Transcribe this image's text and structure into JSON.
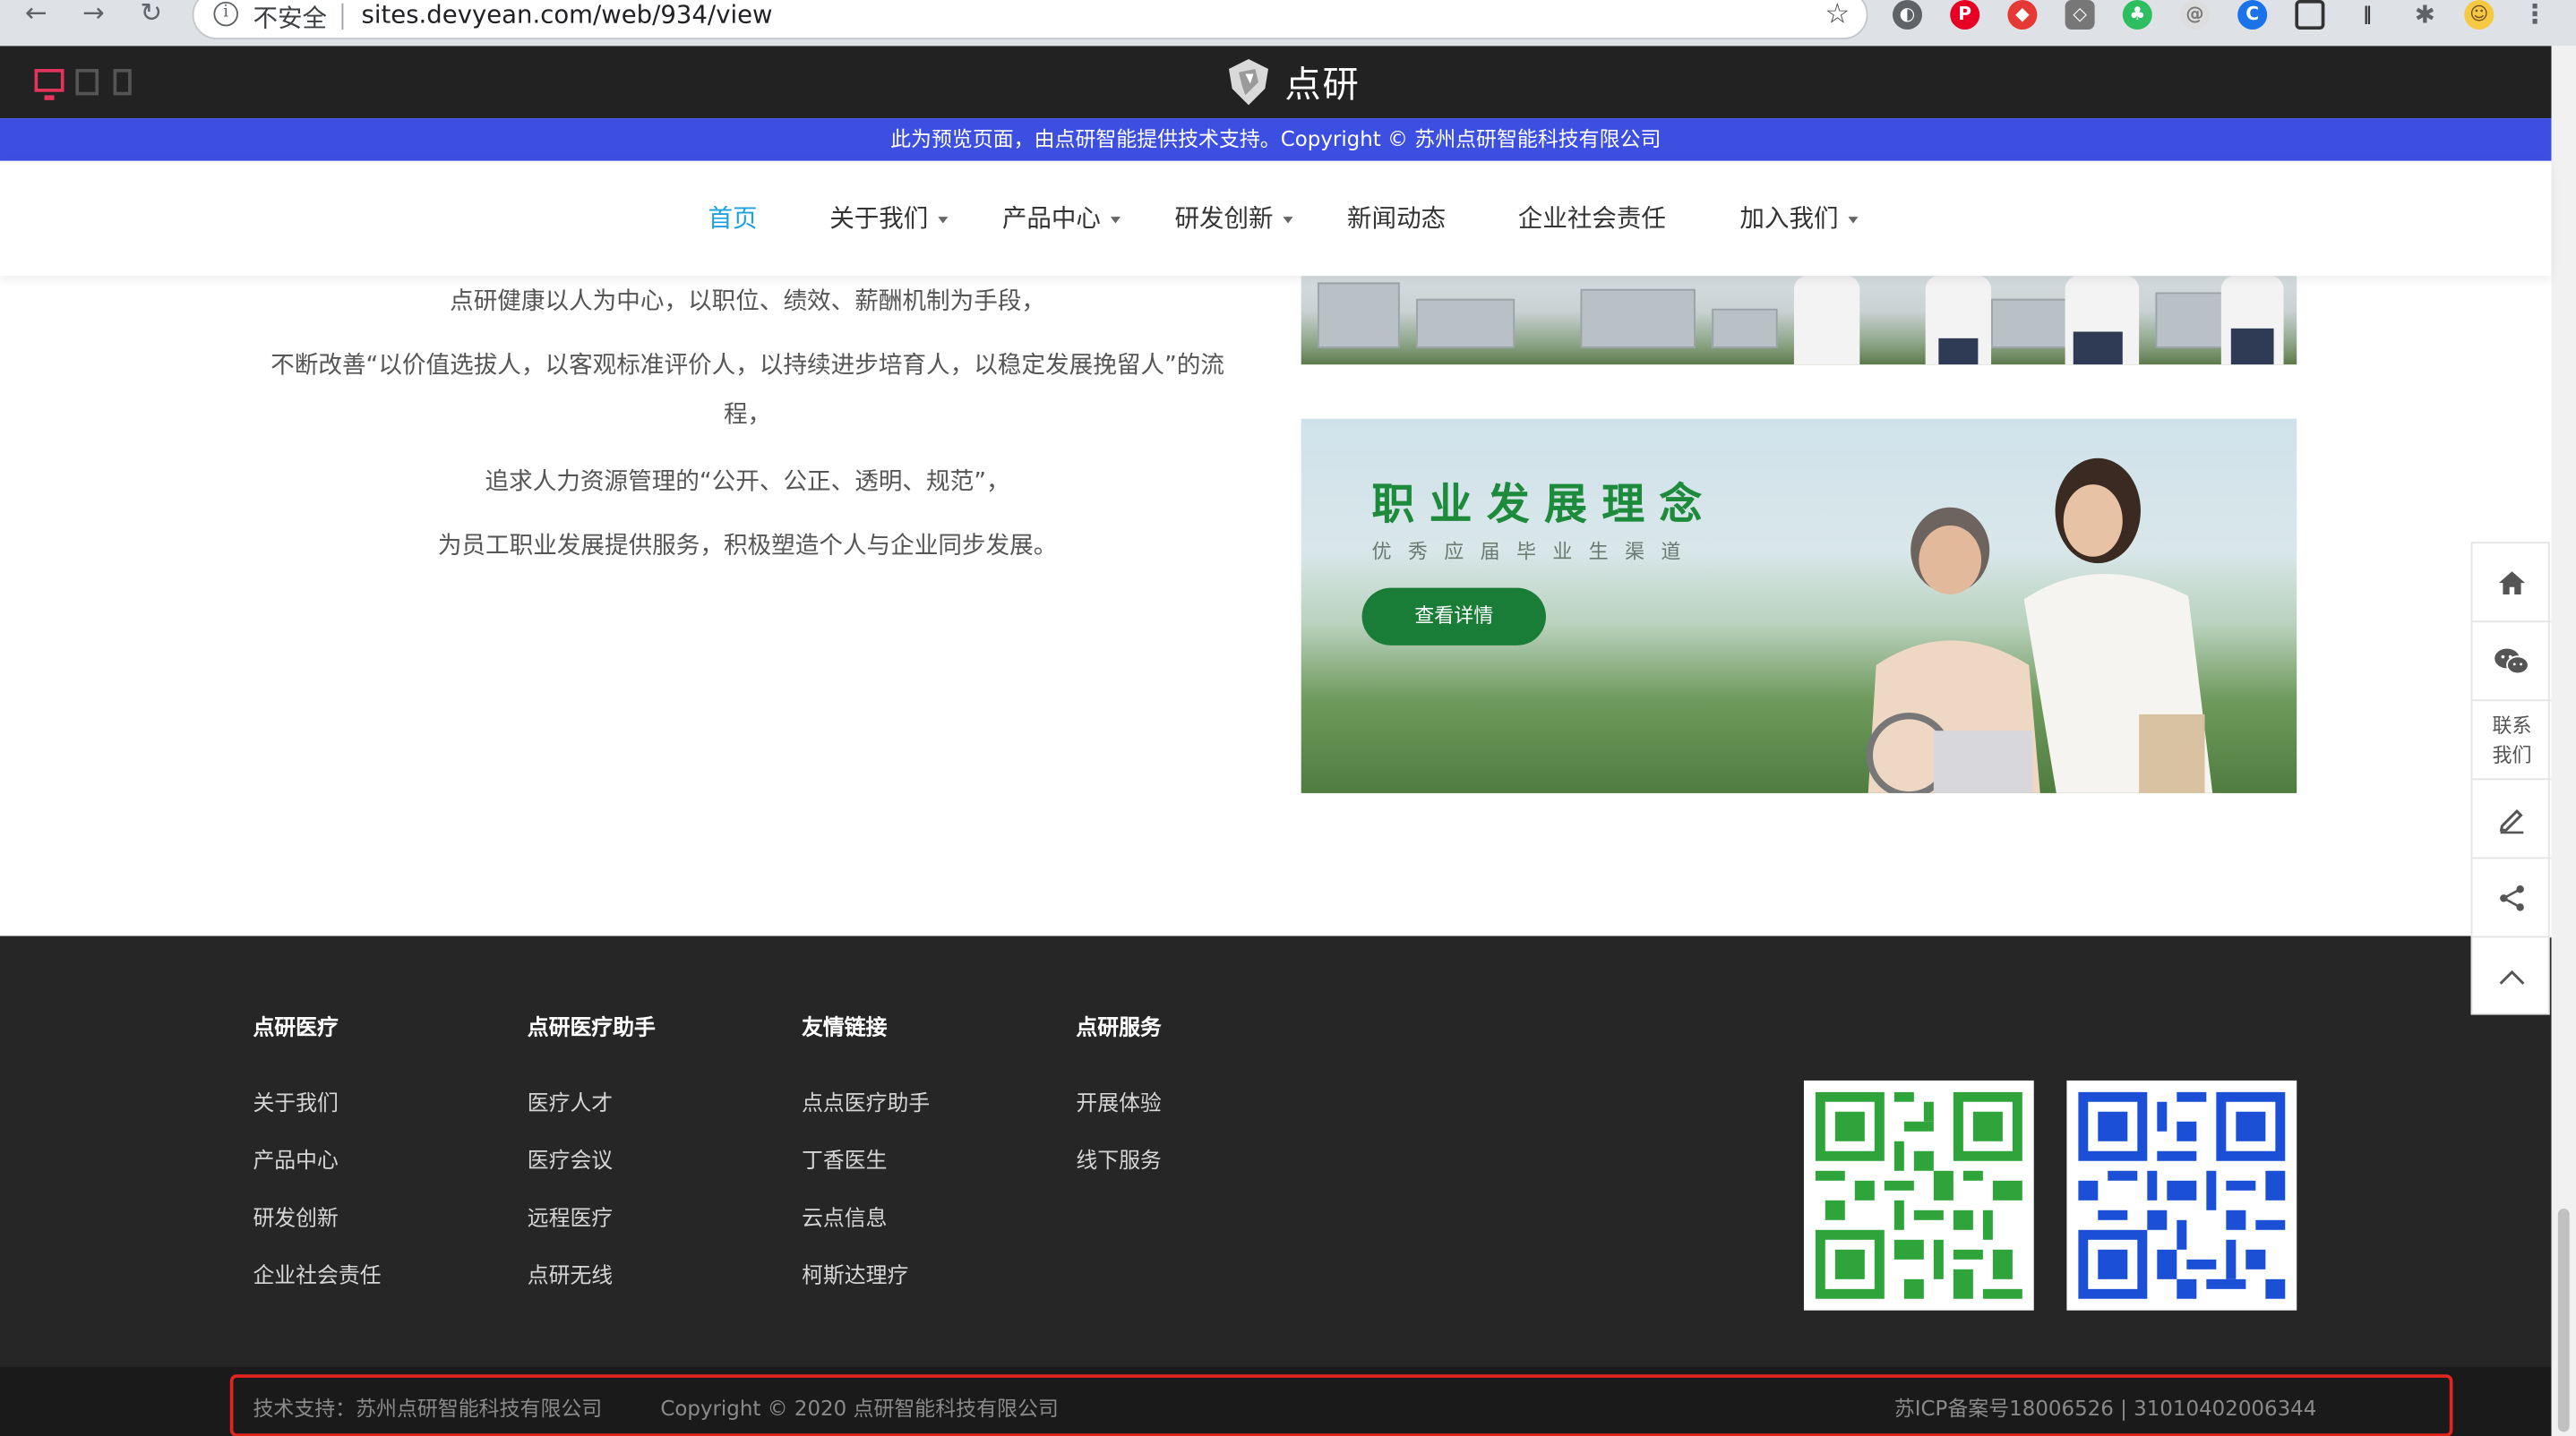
{
  "browser": {
    "insecure_label": "不安全",
    "url": "sites.devyean.com/web/934/view"
  },
  "site": {
    "brand": "点研",
    "notice": "此为预览页面，由点研智能提供技术支持。Copyright © 苏州点研智能科技有限公司"
  },
  "nav": {
    "items": [
      {
        "label": "首页"
      },
      {
        "label": "关于我们"
      },
      {
        "label": "产品中心"
      },
      {
        "label": "研发创新"
      },
      {
        "label": "新闻动态"
      },
      {
        "label": "企业社会责任"
      },
      {
        "label": "加入我们"
      }
    ]
  },
  "content": {
    "paragraphs": [
      "点研健康以人为中心，以职位、绩效、薪酬机制为手段，",
      "不断改善“以价值选拔人，以客观标准评价人，以持续进步培育人，以稳定发展挽留人”的流程，",
      "追求人力资源管理的“公开、公正、透明、规范”，",
      "为员工职业发展提供服务，积极塑造个人与企业同步发展。"
    ],
    "banner": {
      "title": "职业发展理念",
      "subtitle": "优秀应届毕业生渠道",
      "button": "查看详情"
    }
  },
  "footer": {
    "columns": [
      {
        "title": "点研医疗",
        "links": [
          "关于我们",
          "产品中心",
          "研发创新",
          "企业社会责任"
        ]
      },
      {
        "title": "点研医疗助手",
        "links": [
          "医疗人才",
          "医疗会议",
          "远程医疗",
          "点研无线"
        ]
      },
      {
        "title": "友情链接",
        "links": [
          "点点医疗助手",
          "丁香医生",
          "云点信息",
          "柯斯达理疗"
        ]
      },
      {
        "title": "点研服务",
        "links": [
          "开展体验",
          "线下服务"
        ]
      }
    ],
    "tech_support": "技术支持：苏州点研智能科技有限公司",
    "copyright": "Copyright © 2020 点研智能科技有限公司",
    "icp": "苏ICP备案号18006526 | 31010402006344"
  },
  "sidebar": {
    "contact_line1": "联系",
    "contact_line2": "我们"
  },
  "colors": {
    "notice_bg": "#3c4fe0",
    "nav_active": "#1ea0dc",
    "banner_green": "#1e8a3c",
    "highlight_red": "#e5241f"
  }
}
